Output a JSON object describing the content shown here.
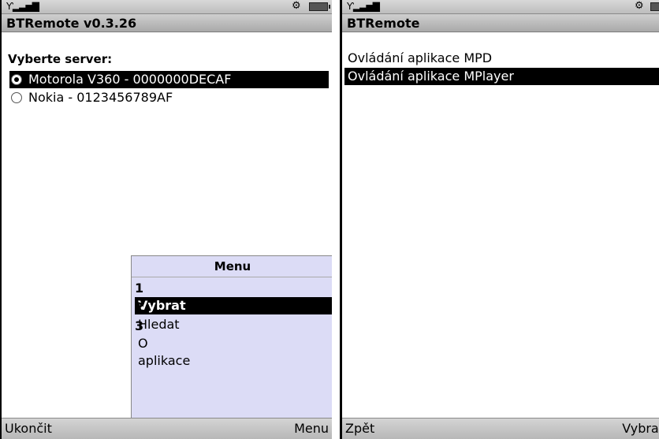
{
  "left_screen": {
    "title": "BTRemote v0.3.26",
    "heading": "Vyberte server:",
    "servers": [
      {
        "label": "Motorola V360 - 0000000DECAF",
        "selected": true
      },
      {
        "label": "Nokia - 0123456789AF",
        "selected": false
      }
    ],
    "menu": {
      "title": "Menu",
      "items": [
        {
          "number": "1",
          "label": "Vybrat",
          "selected": true
        },
        {
          "number": "2",
          "label": "Hledat",
          "selected": false
        },
        {
          "number": "3",
          "label": "O aplikace",
          "selected": false
        }
      ]
    },
    "softkeys": {
      "left": "Ukončit",
      "right": "Menu"
    }
  },
  "right_screen": {
    "title": "BTRemote",
    "items": [
      {
        "label": "Ovládání aplikace MPD",
        "selected": false
      },
      {
        "label": "Ovládání aplikace MPlayer",
        "selected": true
      }
    ],
    "softkeys": {
      "left": "Zpět",
      "right": "Vybrat"
    }
  },
  "status_icons": {
    "signal": "signal-strength-icon",
    "settings": "gear-icon",
    "battery": "battery-icon"
  }
}
